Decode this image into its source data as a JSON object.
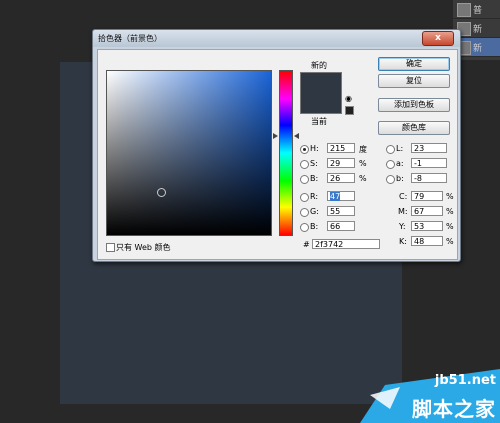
{
  "dialog": {
    "title": "拾色器（前景色）",
    "close": "x",
    "label_new": "新的",
    "label_current": "当前",
    "new_color": "#2f3742",
    "current_color": "#2f3742",
    "buttons": {
      "ok": "确定",
      "reset": "复位",
      "add_to_swatches": "添加到色板",
      "color_libraries": "颜色库"
    },
    "only_web_colors": "只有 Web 颜色",
    "hex_label": "#",
    "hex_value": "2f3742"
  },
  "fields": {
    "H": {
      "label": "H:",
      "value": "215",
      "unit": "度",
      "checked": true
    },
    "S": {
      "label": "S:",
      "value": "29",
      "unit": "%"
    },
    "Bv": {
      "label": "B:",
      "value": "26",
      "unit": "%"
    },
    "R": {
      "label": "R:",
      "value": "47"
    },
    "G": {
      "label": "G:",
      "value": "55"
    },
    "Bc": {
      "label": "B:",
      "value": "66"
    },
    "L": {
      "label": "L:",
      "value": "23"
    },
    "a": {
      "label": "a:",
      "value": "-1"
    },
    "b": {
      "label": "b:",
      "value": "-8"
    },
    "C": {
      "label": "C:",
      "value": "79",
      "unit": "%"
    },
    "M": {
      "label": "M:",
      "value": "67",
      "unit": "%"
    },
    "Y": {
      "label": "Y:",
      "value": "53",
      "unit": "%"
    },
    "K": {
      "label": "K:",
      "value": "48",
      "unit": "%"
    }
  },
  "layers": [
    "普",
    "新",
    "新"
  ],
  "watermark": {
    "url": "jb51.net",
    "name": "脚本之家"
  },
  "colors": {
    "canvas": "#2f3742",
    "accent": "#1a64d8",
    "watermark": "#2aa9e6"
  }
}
